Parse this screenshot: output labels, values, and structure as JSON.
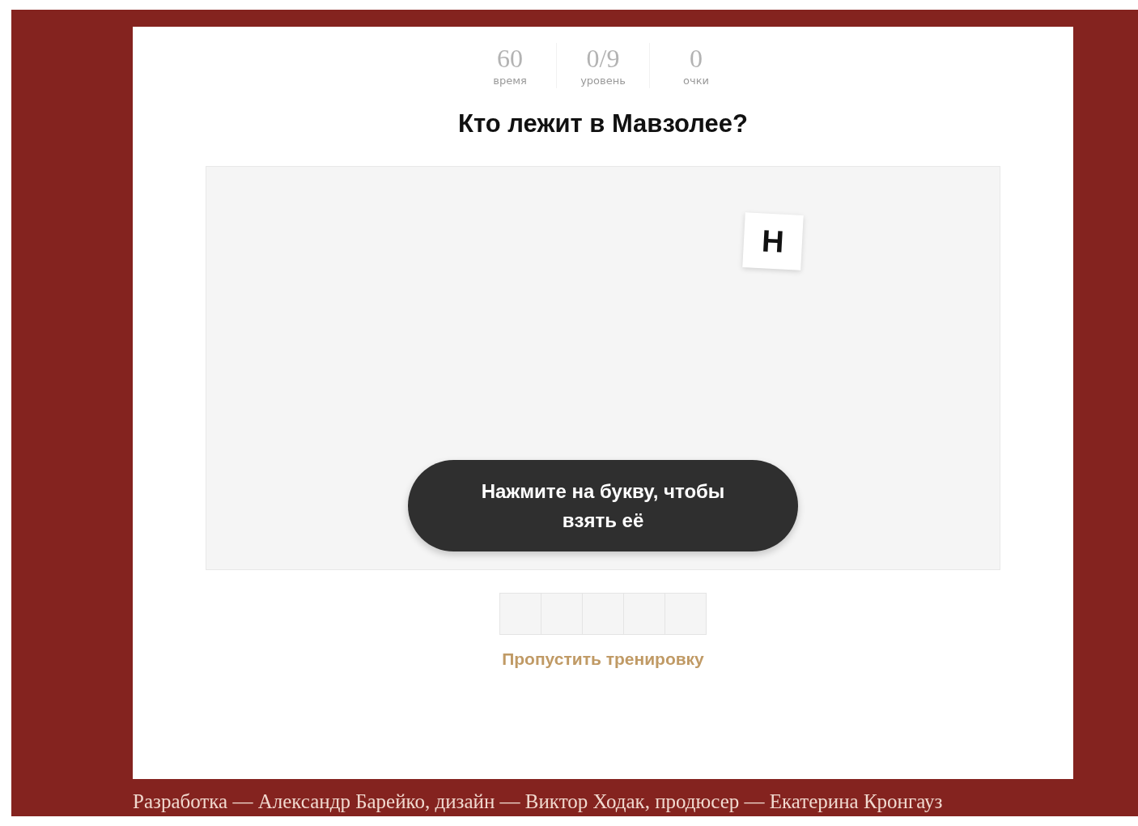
{
  "stats": [
    {
      "value": "60",
      "label": "время"
    },
    {
      "value": "0/9",
      "label": "уровень"
    },
    {
      "value": "0",
      "label": "очки"
    }
  ],
  "question": "Кто лежит в Мавзолее?",
  "tiles": [
    {
      "letter": "Н"
    }
  ],
  "hint": "Нажмите на букву, чтобы взять её",
  "answer_slots": [
    {
      "filled": false
    },
    {
      "filled": false
    },
    {
      "filled": false
    },
    {
      "filled": false
    },
    {
      "filled": false
    }
  ],
  "skip_link": "Пропустить тренировку",
  "footer": "Разработка — Александр Барейко, дизайн — Виктор Ходак, продюсер — Екатерина Кронгауз"
}
